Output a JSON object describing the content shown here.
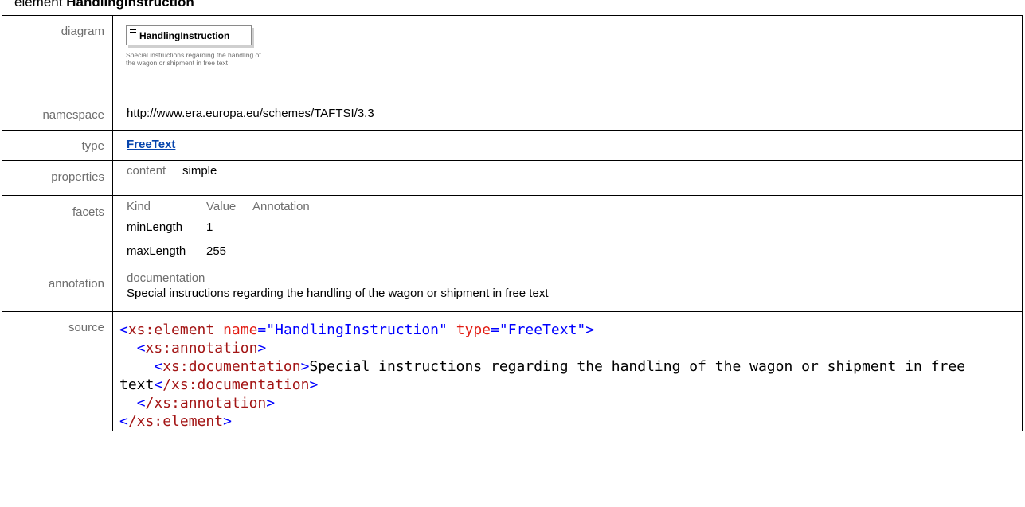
{
  "heading": {
    "prefix": "element",
    "name": "HandlingInstruction"
  },
  "labels": {
    "diagram": "diagram",
    "namespace": "namespace",
    "type": "type",
    "properties": "properties",
    "facets": "facets",
    "annotation": "annotation",
    "source": "source"
  },
  "diagram": {
    "box_title": "HandlingInstruction",
    "note": "Special instructions regarding the handling of the wagon or shipment in free text"
  },
  "namespace": "http://www.era.europa.eu/schemes/TAFTSI/3.3",
  "type": {
    "label": "FreeText"
  },
  "properties": {
    "key": "content",
    "value": "simple"
  },
  "facets": {
    "headers": [
      "Kind",
      "Value",
      "Annotation"
    ],
    "rows": [
      {
        "kind": "minLength",
        "value": "1"
      },
      {
        "kind": "maxLength",
        "value": "255"
      }
    ]
  },
  "annotation": {
    "heading": "documentation",
    "text": "Special instructions regarding the handling of the wagon or shipment in free text"
  },
  "source": {
    "l1_tag": "xs:element",
    "l1_a1": "name",
    "l1_v1": "\"HandlingInstruction\"",
    "l1_a2": "type",
    "l1_v2": "\"FreeText\"",
    "l2_tag": "xs:annotation",
    "l3_tag": "xs:documentation",
    "l3_text": "Special instructions regarding the handling of the wagon or shipment in free text",
    "l3_close": "/xs:documentation",
    "l4_close": "/xs:annotation",
    "l5_close": "/xs:element"
  }
}
